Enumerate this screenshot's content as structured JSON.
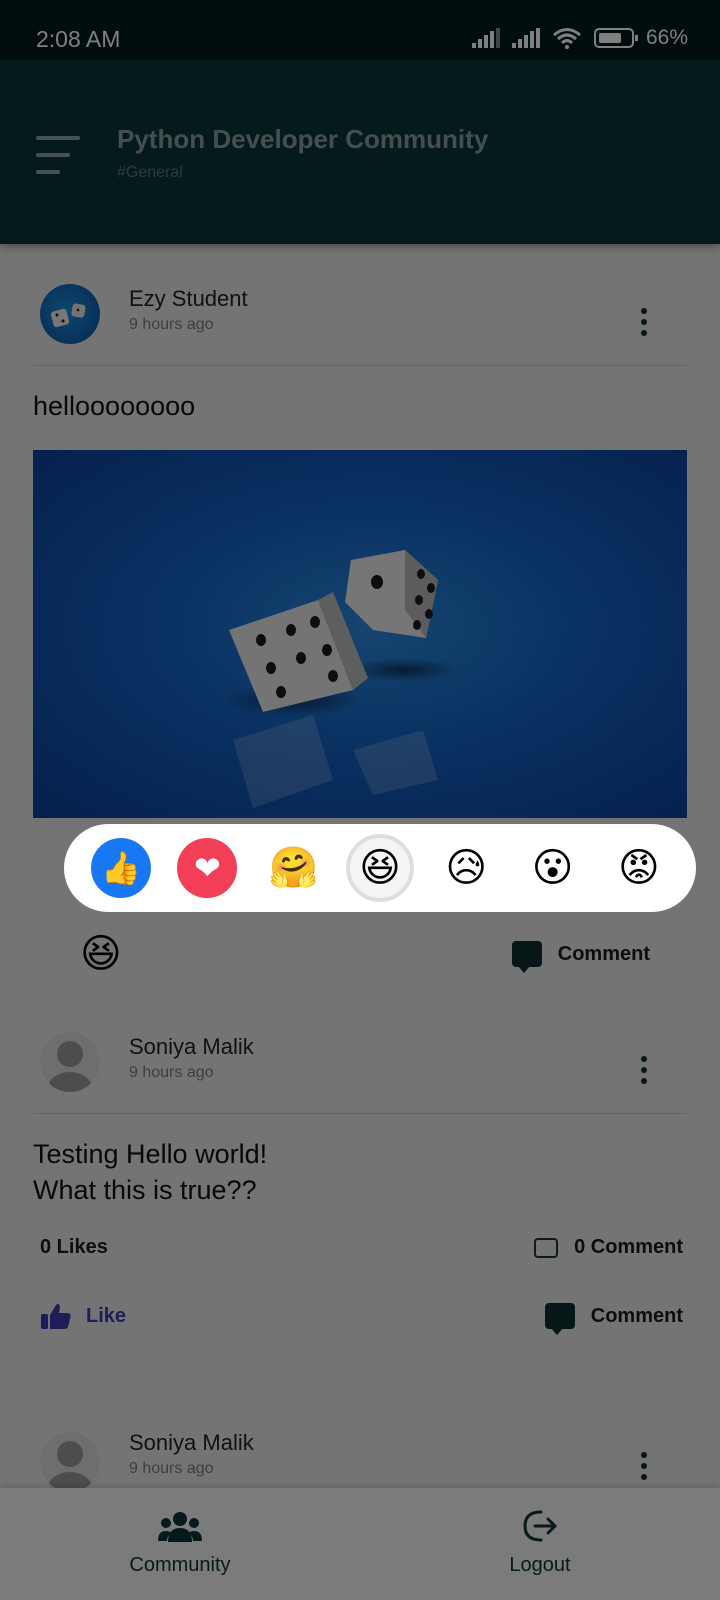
{
  "status_bar": {
    "time": "2:08 AM",
    "battery": "66"
  },
  "header": {
    "title": "Python Developer Community",
    "subtitle": "#General"
  },
  "posts": [
    {
      "author": "Ezy Student",
      "time": "9 hours ago",
      "text": "helloooooooo",
      "actions": {
        "comment": "Comment"
      }
    },
    {
      "author": "Soniya Malik",
      "time": "9 hours ago",
      "text_line1": "Testing Hello world!",
      "text_line2": "What this is true??",
      "likes": "0 Likes",
      "comments": "0 Comment",
      "actions": {
        "like": "Like",
        "comment": "Comment"
      }
    },
    {
      "author": "Soniya Malik",
      "time": "9 hours ago"
    }
  ],
  "reactions": [
    {
      "name": "like",
      "glyph": "👍",
      "color": "#1877f2"
    },
    {
      "name": "love",
      "glyph": "❤",
      "color": "#f33e58"
    },
    {
      "name": "care",
      "glyph": "🤗",
      "color": "#f7b125"
    },
    {
      "name": "haha",
      "glyph": "😆",
      "color": "#f7b125",
      "selected": true
    },
    {
      "name": "sad",
      "glyph": "😥",
      "color": "#f7b125"
    },
    {
      "name": "wow",
      "glyph": "😮",
      "color": "#f7b125"
    },
    {
      "name": "angry",
      "glyph": "😡",
      "color": "#e9710f"
    }
  ],
  "bottom_nav": {
    "community": "Community",
    "logout": "Logout"
  },
  "colors": {
    "header_bg": "#0b3436",
    "status_bg": "#011a1c",
    "accent_like": "#3b3bb3"
  }
}
